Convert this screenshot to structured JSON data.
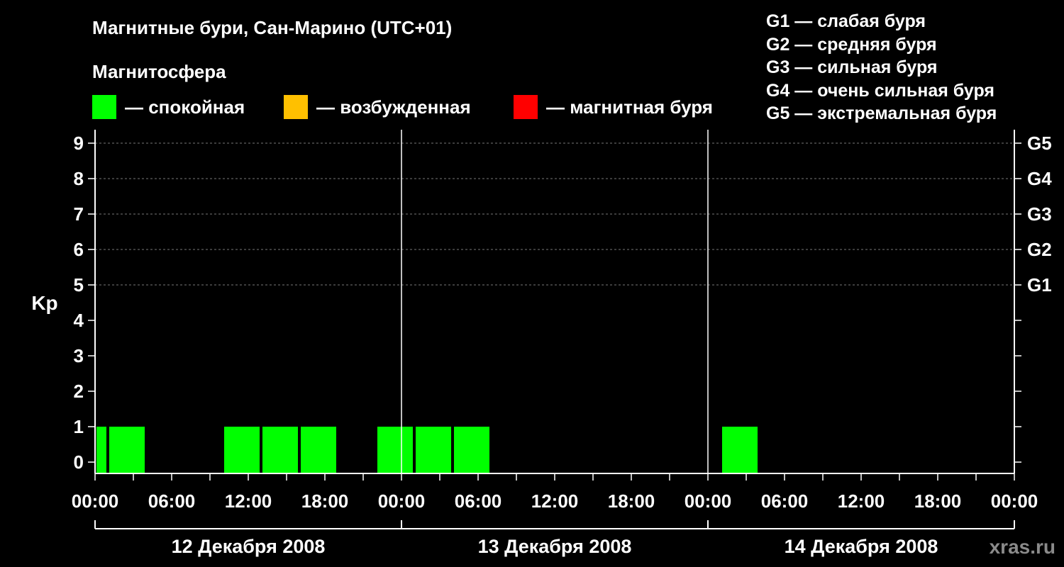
{
  "title": "Магнитные бури, Сан-Марино (UTC+01)",
  "subtitle": "Магнитосфера",
  "legend": [
    {
      "color": "#00ff00",
      "label": "— спокойная"
    },
    {
      "color": "#ffc000",
      "label": "— возбужденная"
    },
    {
      "color": "#ff0000",
      "label": "— магнитная буря"
    }
  ],
  "g_scale": [
    "G1 — слабая буря",
    "G2 — средняя буря",
    "G3 — сильная буря",
    "G4 — очень сильная буря",
    "G5 — экстремальная буря"
  ],
  "watermark": "xras.ru",
  "chart_data": {
    "type": "bar",
    "ylabel": "Kp",
    "ylim": [
      0,
      9
    ],
    "yticks": [
      "0",
      "1",
      "2",
      "3",
      "4",
      "5",
      "6",
      "7",
      "8",
      "9"
    ],
    "g_ticks": [
      {
        "kp": 5,
        "label": "G1"
      },
      {
        "kp": 6,
        "label": "G2"
      },
      {
        "kp": 7,
        "label": "G3"
      },
      {
        "kp": 8,
        "label": "G4"
      },
      {
        "kp": 9,
        "label": "G5"
      }
    ],
    "x_range_hours": [
      0,
      72
    ],
    "xtick_labels": [
      "00:00",
      "06:00",
      "12:00",
      "18:00",
      "00:00",
      "06:00",
      "12:00",
      "18:00",
      "00:00",
      "06:00",
      "12:00",
      "18:00",
      "00:00"
    ],
    "days": [
      "12 Декабря 2008",
      "13 Декабря 2008",
      "14 Декабря 2008"
    ],
    "grid": true,
    "bars": [
      {
        "start": "12 Декабря 2008 00:00",
        "end": "12 Декабря 2008 01:00",
        "kp": 1,
        "color": "#00ff00"
      },
      {
        "start": "12 Декабря 2008 01:00",
        "end": "12 Декабря 2008 04:00",
        "kp": 1,
        "color": "#00ff00"
      },
      {
        "start": "12 Декабря 2008 10:00",
        "end": "12 Декабря 2008 13:00",
        "kp": 1,
        "color": "#00ff00"
      },
      {
        "start": "12 Декабря 2008 13:00",
        "end": "12 Декабря 2008 16:00",
        "kp": 1,
        "color": "#00ff00"
      },
      {
        "start": "12 Декабря 2008 16:00",
        "end": "12 Декабря 2008 19:00",
        "kp": 1,
        "color": "#00ff00"
      },
      {
        "start": "12 Декабря 2008 22:00",
        "end": "13 Декабря 2008 01:00",
        "kp": 1,
        "color": "#00ff00"
      },
      {
        "start": "13 Декабря 2008 01:00",
        "end": "13 Декабря 2008 04:00",
        "kp": 1,
        "color": "#00ff00"
      },
      {
        "start": "13 Декабря 2008 04:00",
        "end": "13 Декабря 2008 07:00",
        "kp": 1,
        "color": "#00ff00"
      },
      {
        "start": "14 Декабря 2008 01:00",
        "end": "14 Декабря 2008 04:00",
        "kp": 1,
        "color": "#00ff00"
      }
    ]
  }
}
